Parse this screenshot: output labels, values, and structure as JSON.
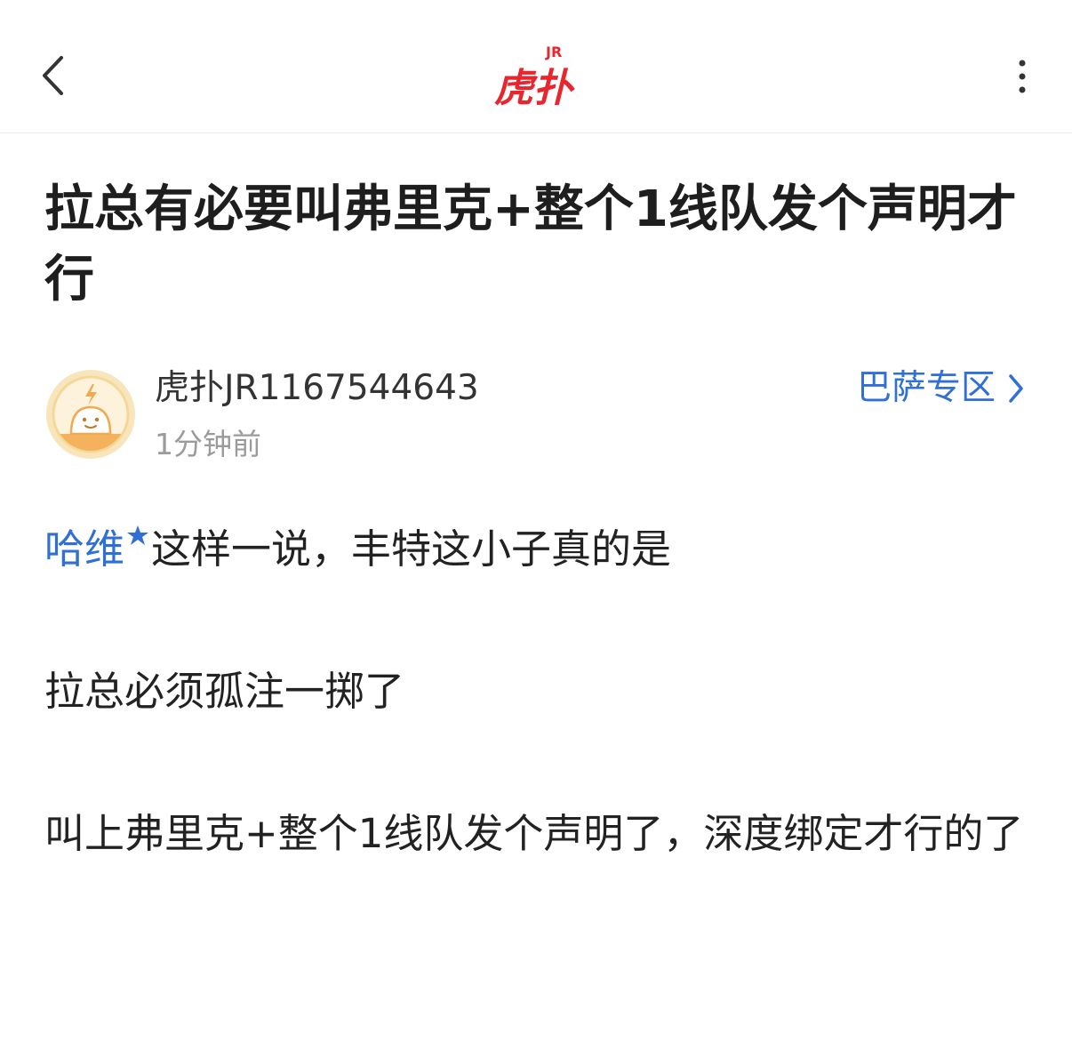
{
  "topbar": {
    "back_icon": "chevron-left-icon",
    "logo_text": "虎扑",
    "logo_badge": "JR",
    "more_icon": "more-vertical-icon"
  },
  "post": {
    "title": "拉总有必要叫弗里克+整个1线队发个声明才行",
    "author": {
      "name": "虎扑JR1167544643",
      "time": "1分钟前",
      "avatar_icon": "default-avatar-icon"
    },
    "forum_link": {
      "label": "巴萨专区",
      "icon": "chevron-right-icon"
    },
    "body": {
      "mention": "哈维",
      "mention_icon": "star-icon",
      "line1_rest": "这样一说，丰特这小子真的是",
      "line2": "拉总必须孤注一掷了",
      "line3": "叫上弗里克+整个1线队发个声明了，深度绑定才行的了"
    }
  },
  "colors": {
    "accent_blue": "#2f6fd6",
    "brand_red": "#e8262d",
    "avatar_ring": "#f3d898",
    "avatar_orange": "#f5b25e"
  }
}
